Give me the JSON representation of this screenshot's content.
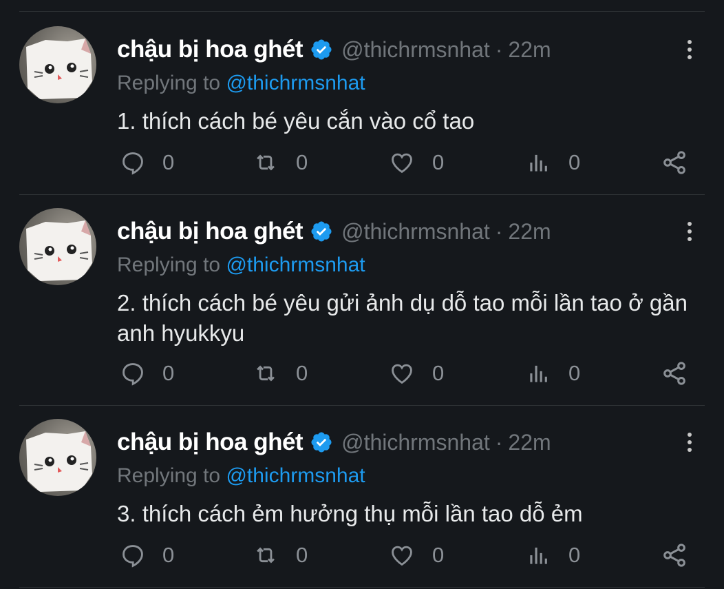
{
  "tweets": [
    {
      "display_name": "chậu bị hoa ghét",
      "handle": "@thichrmsnhat",
      "separator": "·",
      "time": "22m",
      "replying_prefix": "Replying to",
      "replying_to": "@thichrmsnhat",
      "text": "1. thích cách bé yêu cắn vào cổ tao",
      "reply_count": "0",
      "retweet_count": "0",
      "like_count": "0",
      "view_count": "0"
    },
    {
      "display_name": "chậu bị hoa ghét",
      "handle": "@thichrmsnhat",
      "separator": "·",
      "time": "22m",
      "replying_prefix": "Replying to",
      "replying_to": "@thichrmsnhat",
      "text": "2. thích cách bé yêu gửi ảnh dụ dỗ tao mỗi lần tao ở gần anh hyukkyu",
      "reply_count": "0",
      "retweet_count": "0",
      "like_count": "0",
      "view_count": "0"
    },
    {
      "display_name": "chậu bị hoa ghét",
      "handle": "@thichrmsnhat",
      "separator": "·",
      "time": "22m",
      "replying_prefix": "Replying to",
      "replying_to": "@thichrmsnhat",
      "text": "3. thích cách ẻm hưởng thụ mỗi lần tao dỗ ẻm",
      "reply_count": "0",
      "retweet_count": "0",
      "like_count": "0",
      "view_count": "0"
    }
  ],
  "icons": {
    "reply": "reply-icon",
    "retweet": "retweet-icon",
    "like": "heart-icon",
    "views": "analytics-icon",
    "share": "share-icon",
    "verified": "verified-badge-icon",
    "more": "more-options-icon"
  },
  "colors": {
    "background": "#15181c",
    "name": "#ffffff",
    "muted": "#71767b",
    "mention": "#1d9bf0",
    "verified": "#1d9bf0",
    "divider": "#2f3336"
  }
}
